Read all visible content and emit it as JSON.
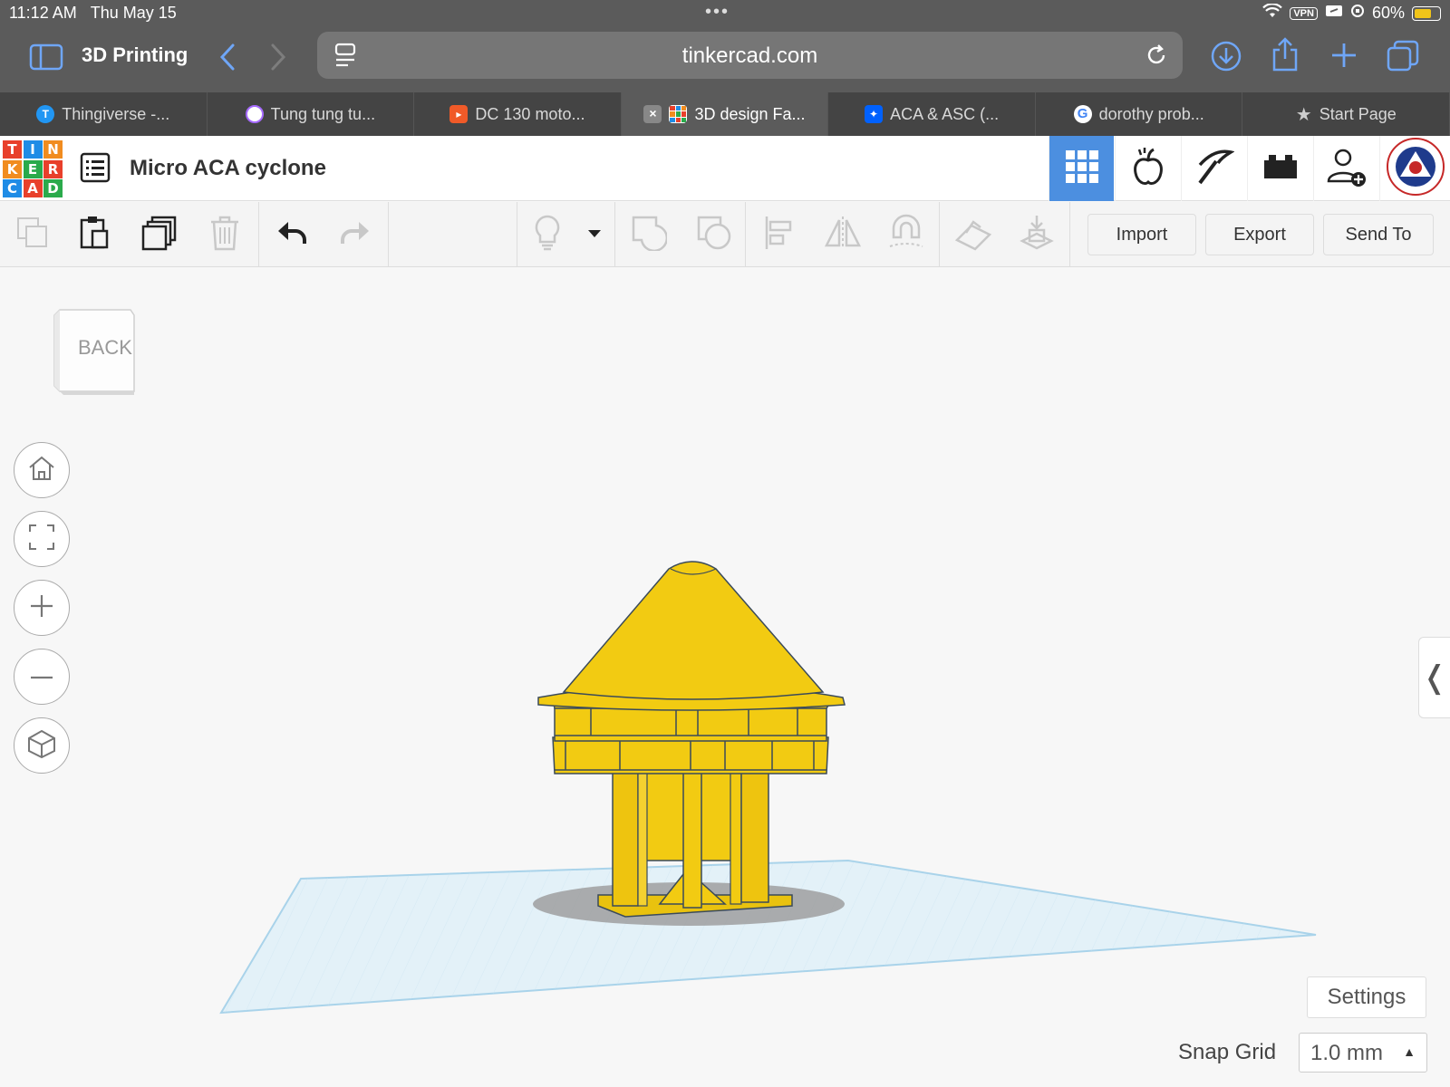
{
  "status_bar": {
    "time": "11:12 AM",
    "date": "Thu May 15",
    "vpn": "VPN",
    "battery": "60%"
  },
  "browser": {
    "group_title": "3D Printing",
    "url": "tinkercad.com",
    "tabs": [
      {
        "label": "Thingiverse -...",
        "icon": "thingiverse-icon",
        "color": "#2196f3"
      },
      {
        "label": "Tung tung tu...",
        "icon": "chat-icon",
        "color": "#a66bff"
      },
      {
        "label": "DC 130 moto...",
        "icon": "orange-page-icon",
        "color": "#f05a28"
      },
      {
        "label": "3D design Fa...",
        "icon": "tinkercad-icon",
        "color": "#e24c3c",
        "active": true
      },
      {
        "label": "ACA & ASC (...",
        "icon": "dropbox-icon",
        "color": "#0061fe"
      },
      {
        "label": "dorothy prob...",
        "icon": "google-icon",
        "color": "#4285f4"
      },
      {
        "label": "Start Page",
        "icon": "star-icon",
        "color": "#cccccc"
      }
    ]
  },
  "tinkercad": {
    "logo_letters": [
      "T",
      "I",
      "N",
      "K",
      "E",
      "R",
      "C",
      "A",
      "D"
    ],
    "logo_colors": [
      "#e8402b",
      "#1f8ce6",
      "#f18c1f",
      "#f18c1f",
      "#2aaa4b",
      "#e8402b",
      "#1f8ce6",
      "#e8402b",
      "#2aaa4b"
    ],
    "design_title": "Micro ACA cyclone",
    "toolbar": {
      "import_label": "Import",
      "export_label": "Export",
      "send_to_label": "Send To"
    },
    "viewcube_label": "BACK",
    "settings_label": "Settings",
    "snap_grid_label": "Snap Grid",
    "snap_grid_value": "1.0 mm",
    "accent": "#4c8fe0",
    "model_color": "#f2cb12"
  }
}
